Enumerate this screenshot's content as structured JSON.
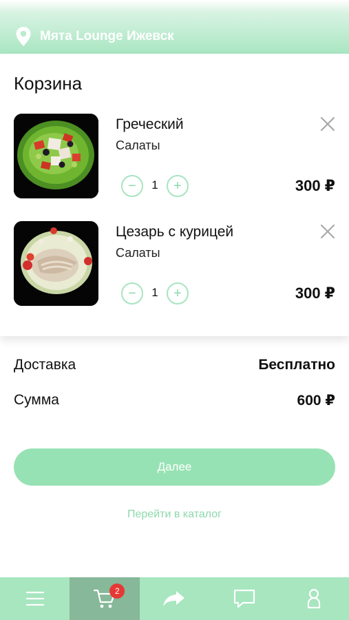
{
  "header": {
    "location": "Мята Lounge Ижевск"
  },
  "cart": {
    "title": "Корзина",
    "items": [
      {
        "name": "Греческий",
        "category": "Салаты",
        "quantity": "1",
        "price": "300 ₽",
        "image_icon": "greek-salad-photo"
      },
      {
        "name": "Цезарь с курицей",
        "category": "Салаты",
        "quantity": "1",
        "price": "300 ₽",
        "image_icon": "caesar-salad-photo"
      }
    ]
  },
  "summary": {
    "delivery_label": "Доставка",
    "delivery_value": "Бесплатно",
    "total_label": "Сумма",
    "total_value": "600 ₽"
  },
  "actions": {
    "next_label": "Далее",
    "catalog_link": "Перейти в каталог"
  },
  "tabbar": {
    "cart_badge": "2",
    "tabs": [
      "menu-icon",
      "cart-icon",
      "share-icon",
      "chat-icon",
      "profile-icon"
    ]
  },
  "colors": {
    "accent": "#97e2b4",
    "tabbar": "#a7e6bf",
    "tab_active": "#86b899",
    "badge": "#e53935",
    "link": "#8dd9ac"
  }
}
